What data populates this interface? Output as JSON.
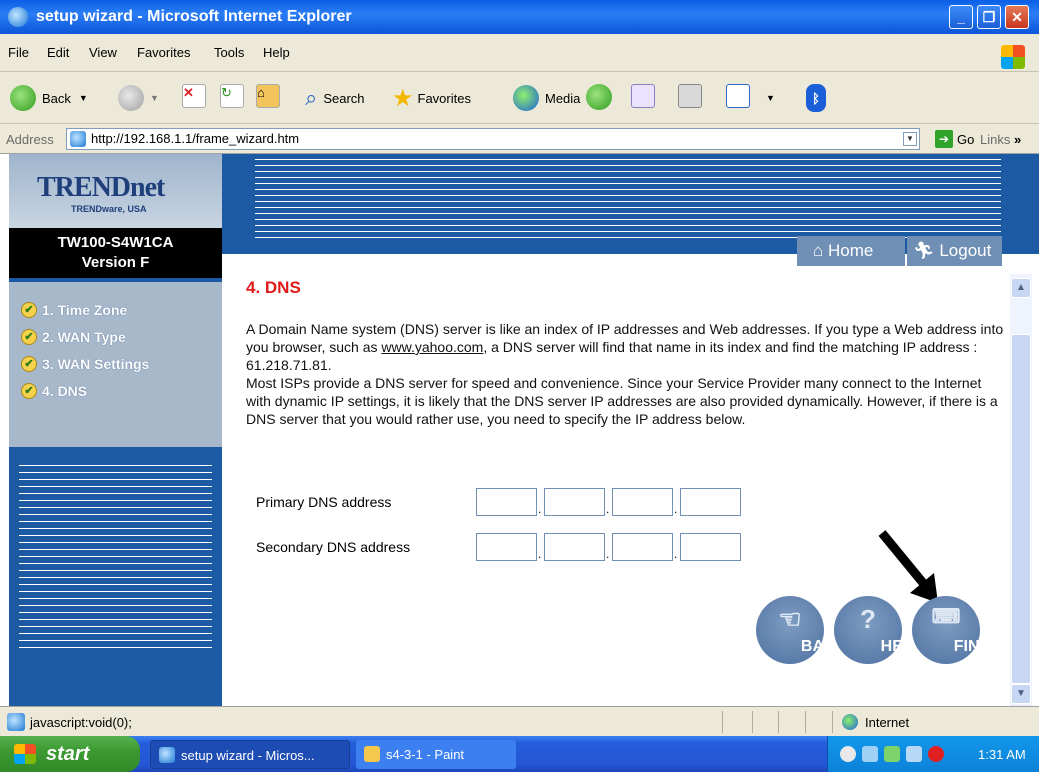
{
  "window": {
    "title": "setup wizard - Microsoft Internet Explorer"
  },
  "menu": [
    "File",
    "Edit",
    "View",
    "Favorites",
    "Tools",
    "Help"
  ],
  "toolbar": {
    "back": "Back",
    "search": "Search",
    "favorites": "Favorites",
    "media": "Media"
  },
  "address": {
    "label": "Address",
    "url": "http://192.168.1.1/frame_wizard.htm",
    "go": "Go",
    "links": "Links"
  },
  "sidebar": {
    "logo": "TRENDnet",
    "logo_sub": "TRENDware, USA",
    "model": "TW100-S4W1CA",
    "version": "Version F",
    "steps": [
      "1. Time Zone",
      "2. WAN Type",
      "3. WAN Settings",
      "4. DNS"
    ]
  },
  "nav": {
    "home": "Home",
    "logout": "Logout"
  },
  "main": {
    "heading": "4. DNS",
    "para1_pre": "A Domain Name system (DNS) server is like an index of IP addresses and Web addresses. If you type a Web address into you browser, such as ",
    "para1_link": "www.yahoo.com",
    "para1_post": ", a DNS server will find that name in its index and find the matching IP address : 61.218.71.81.",
    "para2": "Most ISPs provide a DNS server for speed and convenience. Since your Service Provider many connect to the Internet with dynamic IP settings, it is likely that the DNS server IP addresses are also provided dynamically. However, if there is a DNS server that you would rather use, you need to specify the IP address below.",
    "primary_label": "Primary DNS address",
    "secondary_label": "Secondary DNS address",
    "buttons": {
      "back": "BACK",
      "help": "HELP",
      "finish": "FINISH"
    }
  },
  "status": {
    "text": "javascript:void(0);",
    "zone": "Internet"
  },
  "taskbar": {
    "start": "start",
    "tasks": [
      "setup wizard - Micros...",
      "s4-3-1 - Paint"
    ],
    "clock": "1:31 AM"
  }
}
